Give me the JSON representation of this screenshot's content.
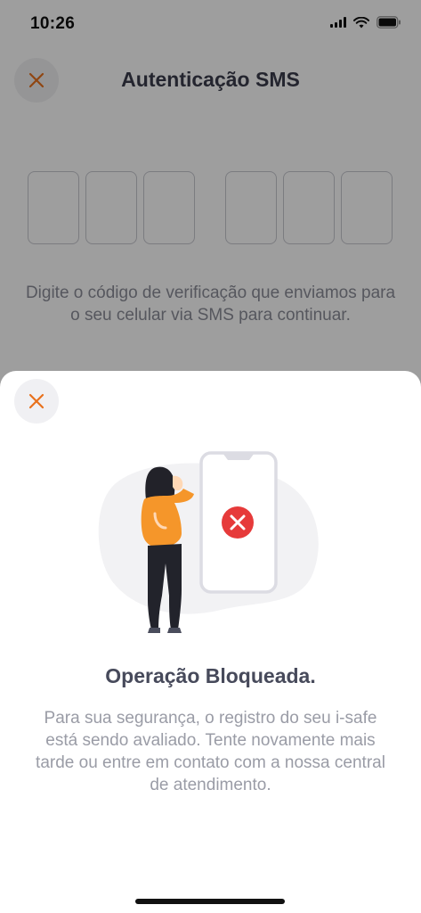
{
  "status_bar": {
    "time": "10:26"
  },
  "auth_screen": {
    "title": "Autenticação SMS",
    "instructions": "Digite o código de verificação que enviamos para o seu celular via SMS para continuar.",
    "code_digits": [
      "",
      "",
      "",
      "",
      "",
      ""
    ]
  },
  "blocked_sheet": {
    "title": "Operação Bloqueada.",
    "message": "Para sua segurança, o registro do seu i-safe está sendo avaliado. Tente novamente mais tarde ou entre em contato com a nossa central de atendimento."
  },
  "colors": {
    "accent": "#e8711c",
    "error": "#e63a3a",
    "shirt": "#f5962a",
    "text_dark": "#474a5b",
    "text_muted": "#9a9ca6"
  },
  "icons": {
    "close": "close-icon",
    "wifi": "wifi-icon",
    "battery": "battery-icon",
    "signal": "signal-icon",
    "error": "error-x-icon"
  }
}
